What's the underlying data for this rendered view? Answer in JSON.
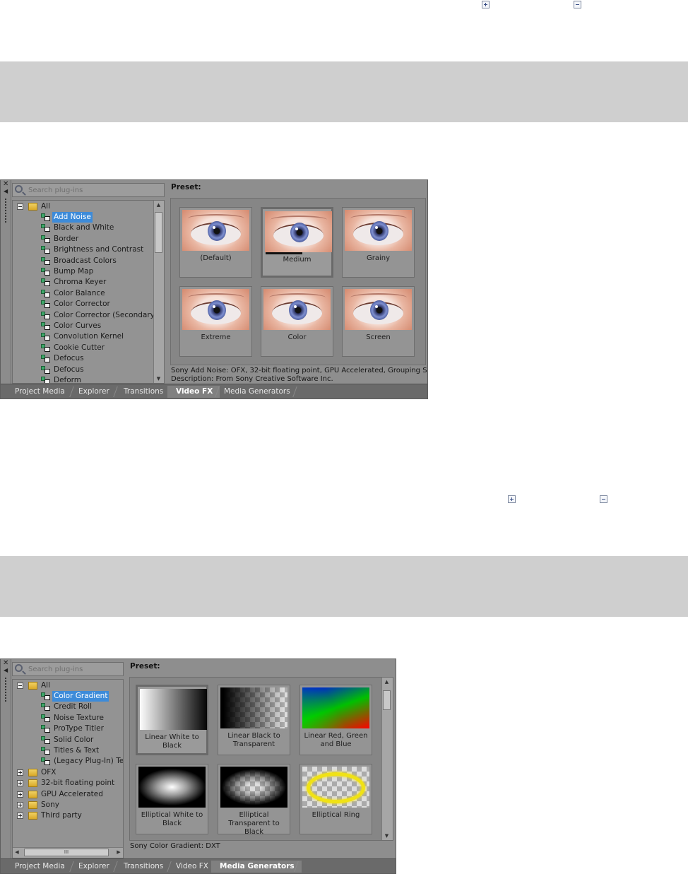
{
  "section1": {
    "expand_labels": [
      "+",
      "−"
    ],
    "panel": {
      "search_placeholder": "Search plug-ins",
      "tree": {
        "root": "All",
        "items": [
          "Add Noise",
          "Black and White",
          "Border",
          "Brightness and Contrast",
          "Broadcast Colors",
          "Bump Map",
          "Chroma Keyer",
          "Color Balance",
          "Color Corrector",
          "Color Corrector (Secondary)",
          "Color Curves",
          "Convolution Kernel",
          "Cookie Cutter",
          "Defocus",
          "Defocus",
          "Deform"
        ],
        "selected": "Add Noise"
      },
      "preset_label": "Preset:",
      "presets": [
        "(Default)",
        "Medium",
        "Grainy",
        "Extreme",
        "Color",
        "Screen"
      ],
      "selected_preset": "Medium",
      "description_line1": "Sony Add Noise: OFX, 32-bit floating point, GPU Accelerated, Grouping Sony\\(",
      "description_line2": "Description: From Sony Creative Software Inc.",
      "tabs": [
        "Project Media",
        "Explorer",
        "Transitions",
        "Video FX",
        "Media Generators"
      ],
      "active_tab": "Video FX"
    }
  },
  "section2": {
    "expand_labels": [
      "+",
      "−"
    ],
    "panel": {
      "search_placeholder": "Search plug-ins",
      "tree": {
        "root": "All",
        "items": [
          "Color Gradient",
          "Credit Roll",
          "Noise Texture",
          "ProType Titler",
          "Solid Color",
          "Titles & Text",
          "(Legacy Plug-In) Text"
        ],
        "folders": [
          "OFX",
          "32-bit floating point",
          "GPU Accelerated",
          "Sony",
          "Third party"
        ],
        "selected": "Color Gradient"
      },
      "hscroll_thumb": "III",
      "preset_label": "Preset:",
      "presets": [
        "Linear White to Black",
        "Linear Black to Transparent",
        "Linear Red, Green and Blue",
        "Elliptical White to Black",
        "Elliptical Transparent to Black",
        "Elliptical Ring"
      ],
      "selected_preset": "Linear White to Black",
      "description_line1": "Sony Color Gradient: DXT",
      "tabs": [
        "Project Media",
        "Explorer",
        "Transitions",
        "Video FX",
        "Media Generators"
      ],
      "active_tab": "Media Generators"
    }
  }
}
